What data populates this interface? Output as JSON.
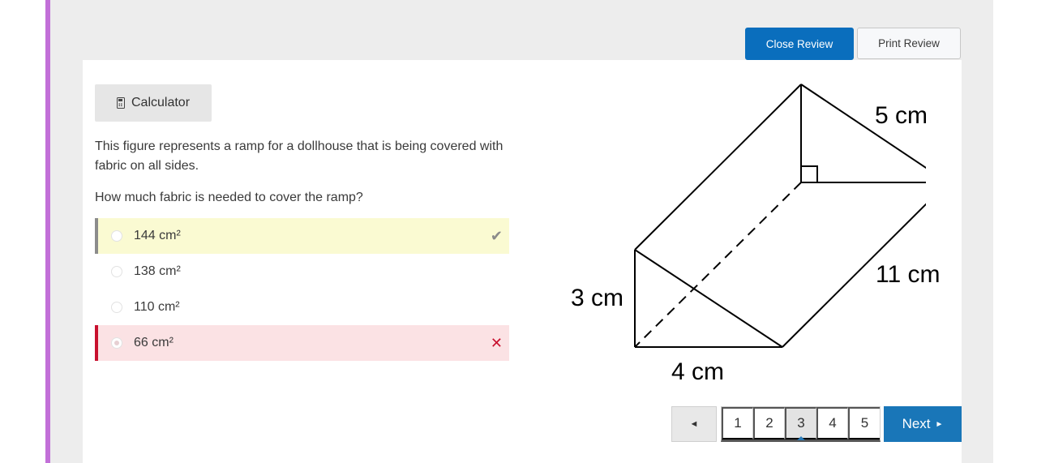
{
  "header": {
    "close_review_label": "Close Review",
    "print_review_label": "Print Review"
  },
  "toolbar": {
    "calculator_label": "Calculator",
    "calculator_icon": "calculator-icon"
  },
  "question": {
    "text": "This figure represents a ramp for a dollhouse that is being covered with fabric on all sides.",
    "prompt": "How much fabric is needed to cover the ramp?"
  },
  "options": [
    {
      "label": "144 cm²",
      "state": "correct",
      "mark_icon": "check-icon",
      "mark": "✔"
    },
    {
      "label": "138 cm²",
      "state": "none"
    },
    {
      "label": "110 cm²",
      "state": "none"
    },
    {
      "label": "66 cm²",
      "state": "selected-wrong",
      "mark_icon": "cross-icon",
      "mark": "✕"
    }
  ],
  "figure": {
    "labels": {
      "hypotenuse": "5 cm",
      "length": "11 cm",
      "height": "3 cm",
      "base": "4 cm"
    }
  },
  "pagination": {
    "prev_icon": "◄",
    "pages": [
      "1",
      "2",
      "3",
      "4",
      "5"
    ],
    "current_page": "3",
    "next_label": "Next",
    "next_icon": "►"
  },
  "colors": {
    "accent_purple": "#c270d8",
    "primary_blue": "#0a6ebd",
    "correct_bg": "#fafad2",
    "wrong_bg": "#fbe2e4",
    "wrong_mark": "#c8102e"
  }
}
